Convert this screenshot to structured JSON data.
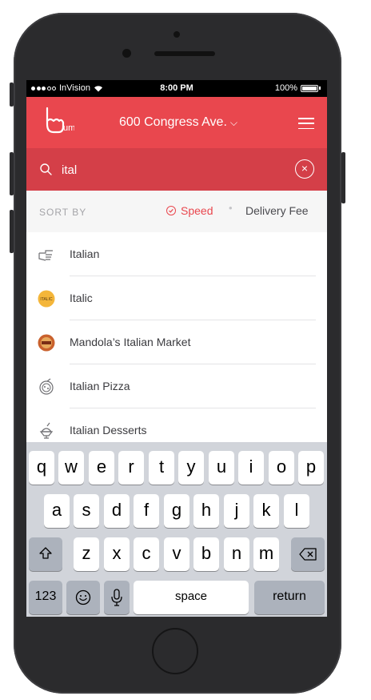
{
  "status_bar": {
    "carrier": "InVision",
    "time": "8:00 PM",
    "battery": "100%"
  },
  "header": {
    "logo_text": "um",
    "address": "600 Congress Ave.",
    "address_chevron": "⌵"
  },
  "search": {
    "value": "ital",
    "clear_label": "×"
  },
  "sort": {
    "label": "SORT BY",
    "options": [
      {
        "label": "Speed",
        "selected": true
      },
      {
        "label": "Delivery Fee",
        "selected": false
      }
    ],
    "separator": "•"
  },
  "results": [
    {
      "label": "Italian",
      "icon": "pointing-hand-icon"
    },
    {
      "label": "Italic",
      "icon": "italic-logo-icon",
      "logo_text": "ITALIC"
    },
    {
      "label": "Mandola’s Italian Market",
      "icon": "mandolas-logo-icon"
    },
    {
      "label": "Italian Pizza",
      "icon": "pizza-icon"
    },
    {
      "label": "Italian Desserts",
      "icon": "sundae-icon"
    }
  ],
  "keyboard": {
    "row1": [
      "q",
      "w",
      "e",
      "r",
      "t",
      "y",
      "u",
      "i",
      "o",
      "p"
    ],
    "row2": [
      "a",
      "s",
      "d",
      "f",
      "g",
      "h",
      "j",
      "k",
      "l"
    ],
    "row3": [
      "z",
      "x",
      "c",
      "v",
      "b",
      "n",
      "m"
    ],
    "numbers_label": "123",
    "space_label": "space",
    "return_label": "return"
  },
  "colors": {
    "brand_red": "#e9474e",
    "search_red": "#d43f48"
  }
}
